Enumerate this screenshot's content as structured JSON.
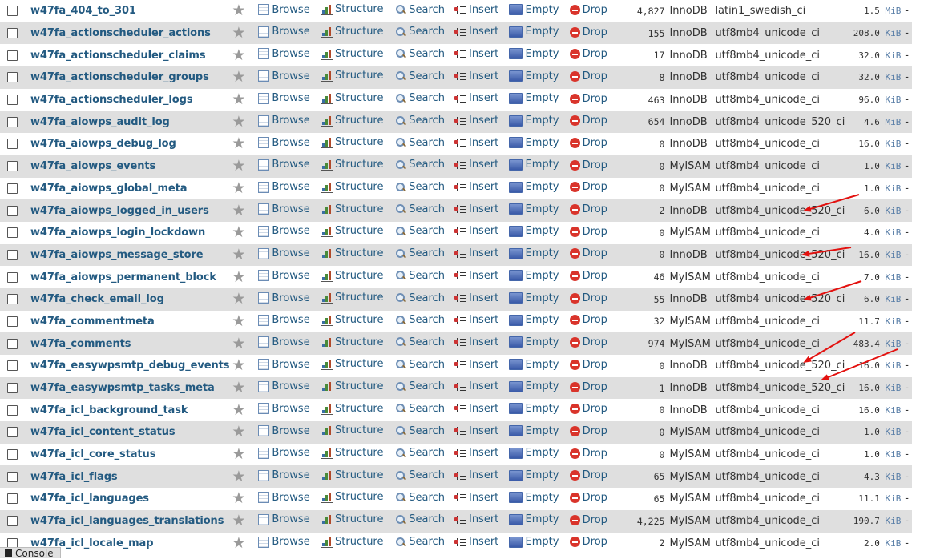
{
  "actions": {
    "browse": "Browse",
    "structure": "Structure",
    "search": "Search",
    "insert": "Insert",
    "empty": "Empty",
    "drop": "Drop"
  },
  "rows": [
    {
      "name": "w47fa_404_to_301",
      "rows": "4,827",
      "type": "InnoDB",
      "collation": "latin1_swedish_ci",
      "size": "1.5",
      "unit": "MiB",
      "overhead": "-"
    },
    {
      "name": "w47fa_actionscheduler_actions",
      "rows": "155",
      "type": "InnoDB",
      "collation": "utf8mb4_unicode_ci",
      "size": "208.0",
      "unit": "KiB",
      "overhead": "-"
    },
    {
      "name": "w47fa_actionscheduler_claims",
      "rows": "17",
      "type": "InnoDB",
      "collation": "utf8mb4_unicode_ci",
      "size": "32.0",
      "unit": "KiB",
      "overhead": "-"
    },
    {
      "name": "w47fa_actionscheduler_groups",
      "rows": "8",
      "type": "InnoDB",
      "collation": "utf8mb4_unicode_ci",
      "size": "32.0",
      "unit": "KiB",
      "overhead": "-"
    },
    {
      "name": "w47fa_actionscheduler_logs",
      "rows": "463",
      "type": "InnoDB",
      "collation": "utf8mb4_unicode_ci",
      "size": "96.0",
      "unit": "KiB",
      "overhead": "-"
    },
    {
      "name": "w47fa_aiowps_audit_log",
      "rows": "654",
      "type": "InnoDB",
      "collation": "utf8mb4_unicode_520_ci",
      "size": "4.6",
      "unit": "MiB",
      "overhead": "-"
    },
    {
      "name": "w47fa_aiowps_debug_log",
      "rows": "0",
      "type": "InnoDB",
      "collation": "utf8mb4_unicode_ci",
      "size": "16.0",
      "unit": "KiB",
      "overhead": "-"
    },
    {
      "name": "w47fa_aiowps_events",
      "rows": "0",
      "type": "MyISAM",
      "collation": "utf8mb4_unicode_ci",
      "size": "1.0",
      "unit": "KiB",
      "overhead": "-"
    },
    {
      "name": "w47fa_aiowps_global_meta",
      "rows": "0",
      "type": "MyISAM",
      "collation": "utf8mb4_unicode_ci",
      "size": "1.0",
      "unit": "KiB",
      "overhead": "-"
    },
    {
      "name": "w47fa_aiowps_logged_in_users",
      "rows": "2",
      "type": "InnoDB",
      "collation": "utf8mb4_unicode_520_ci",
      "size": "6.0",
      "unit": "KiB",
      "overhead": "-"
    },
    {
      "name": "w47fa_aiowps_login_lockdown",
      "rows": "0",
      "type": "MyISAM",
      "collation": "utf8mb4_unicode_ci",
      "size": "4.0",
      "unit": "KiB",
      "overhead": "-"
    },
    {
      "name": "w47fa_aiowps_message_store",
      "rows": "0",
      "type": "InnoDB",
      "collation": "utf8mb4_unicode_520_ci",
      "size": "16.0",
      "unit": "KiB",
      "overhead": "-"
    },
    {
      "name": "w47fa_aiowps_permanent_block",
      "rows": "46",
      "type": "MyISAM",
      "collation": "utf8mb4_unicode_ci",
      "size": "7.0",
      "unit": "KiB",
      "overhead": "-"
    },
    {
      "name": "w47fa_check_email_log",
      "rows": "55",
      "type": "InnoDB",
      "collation": "utf8mb4_unicode_520_ci",
      "size": "6.0",
      "unit": "KiB",
      "overhead": "-"
    },
    {
      "name": "w47fa_commentmeta",
      "rows": "32",
      "type": "MyISAM",
      "collation": "utf8mb4_unicode_ci",
      "size": "11.7",
      "unit": "KiB",
      "overhead": "-"
    },
    {
      "name": "w47fa_comments",
      "rows": "974",
      "type": "MyISAM",
      "collation": "utf8mb4_unicode_ci",
      "size": "483.4",
      "unit": "KiB",
      "overhead": "-"
    },
    {
      "name": "w47fa_easywpsmtp_debug_events",
      "rows": "0",
      "type": "InnoDB",
      "collation": "utf8mb4_unicode_520_ci",
      "size": "16.0",
      "unit": "KiB",
      "overhead": "-"
    },
    {
      "name": "w47fa_easywpsmtp_tasks_meta",
      "rows": "1",
      "type": "InnoDB",
      "collation": "utf8mb4_unicode_520_ci",
      "size": "16.0",
      "unit": "KiB",
      "overhead": "-"
    },
    {
      "name": "w47fa_icl_background_task",
      "rows": "0",
      "type": "InnoDB",
      "collation": "utf8mb4_unicode_ci",
      "size": "16.0",
      "unit": "KiB",
      "overhead": "-"
    },
    {
      "name": "w47fa_icl_content_status",
      "rows": "0",
      "type": "MyISAM",
      "collation": "utf8mb4_unicode_ci",
      "size": "1.0",
      "unit": "KiB",
      "overhead": "-"
    },
    {
      "name": "w47fa_icl_core_status",
      "rows": "0",
      "type": "MyISAM",
      "collation": "utf8mb4_unicode_ci",
      "size": "1.0",
      "unit": "KiB",
      "overhead": "-"
    },
    {
      "name": "w47fa_icl_flags",
      "rows": "65",
      "type": "MyISAM",
      "collation": "utf8mb4_unicode_ci",
      "size": "4.3",
      "unit": "KiB",
      "overhead": "-"
    },
    {
      "name": "w47fa_icl_languages",
      "rows": "65",
      "type": "MyISAM",
      "collation": "utf8mb4_unicode_ci",
      "size": "11.1",
      "unit": "KiB",
      "overhead": "-"
    },
    {
      "name": "w47fa_icl_languages_translations",
      "rows": "4,225",
      "type": "MyISAM",
      "collation": "utf8mb4_unicode_ci",
      "size": "190.7",
      "unit": "KiB",
      "overhead": "-"
    },
    {
      "name": "w47fa_icl_locale_map",
      "rows": "2",
      "type": "MyISAM",
      "collation": "utf8mb4_unicode_ci",
      "size": "2.0",
      "unit": "KiB",
      "overhead": "-"
    }
  ],
  "console": {
    "label": "Console"
  },
  "colors": {
    "link": "#235a81",
    "row_alt": "#dfdfdf",
    "arrow": "#e3110f",
    "drop_icon": "#d9342b"
  }
}
